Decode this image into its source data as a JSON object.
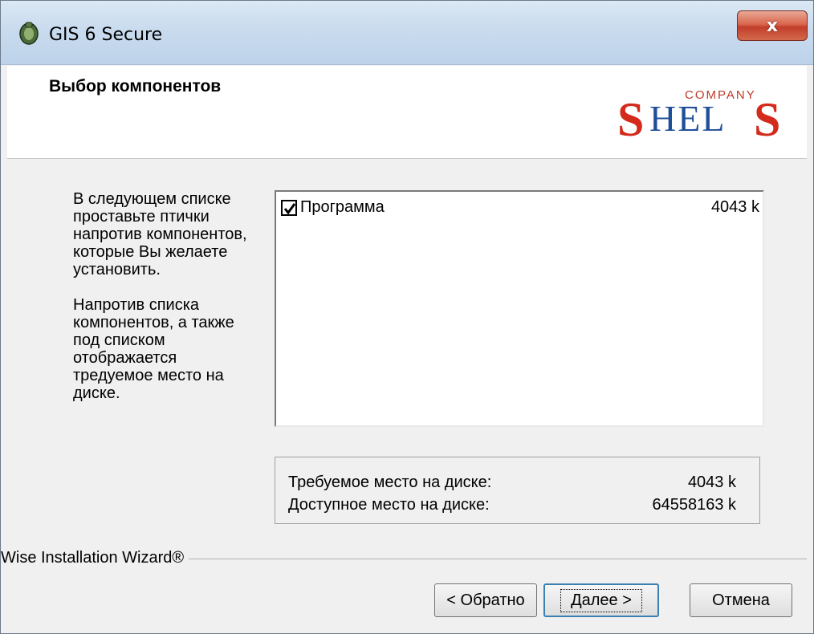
{
  "window": {
    "title": "GIS 6 Secure",
    "close_label": "x"
  },
  "header": {
    "page_title": "Выбор компонентов",
    "logo": {
      "brand_text": "SHELS",
      "sub_text": "COMPANY",
      "colors": {
        "letters_outer": "#d42a1c",
        "letters_inner": "#1e4f98",
        "company": "#c0392b"
      }
    }
  },
  "description": {
    "paragraph1": "В следующем списке проставьте птички напротив компонентов, которые Вы желаете установить.",
    "paragraph2": "Напротив списка компонентов, а также под списком отображается тредуемое место на диске."
  },
  "components": [
    {
      "name": "Программа",
      "size": "4043 k",
      "checked": true
    }
  ],
  "disk": {
    "required_label": "Требуемое место на диске:",
    "required_value": "4043 k",
    "available_label": "Доступное место на диске:",
    "available_value": "64558163 k"
  },
  "footer": {
    "wizard_label": "Wise Installation Wizard®",
    "back_label": "< Обратно",
    "next_label": "Далее >",
    "cancel_label": "Отмена"
  }
}
